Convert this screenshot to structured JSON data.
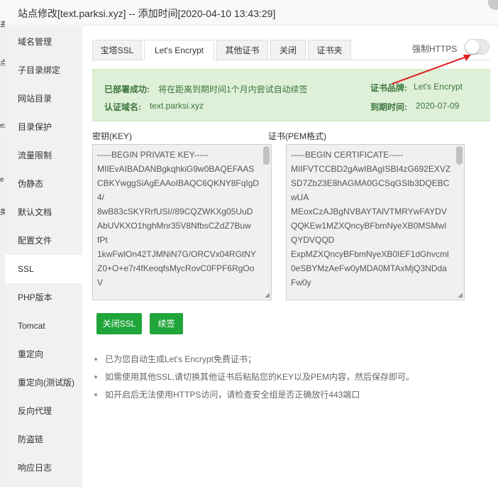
{
  "window": {
    "title": "站点修改[text.parksi.xyz] -- 添加时间[2020-04-10 13:43:29]"
  },
  "left_strip": [
    "丢",
    "点",
    "ext",
    "e",
    "类"
  ],
  "sidebar": {
    "items": [
      {
        "label": "域名管理"
      },
      {
        "label": "子目录绑定"
      },
      {
        "label": "网站目录"
      },
      {
        "label": "目录保护"
      },
      {
        "label": "流量限制"
      },
      {
        "label": "伪静态"
      },
      {
        "label": "默认文档"
      },
      {
        "label": "配置文件"
      },
      {
        "label": "SSL"
      },
      {
        "label": "PHP版本"
      },
      {
        "label": "Tomcat"
      },
      {
        "label": "重定向"
      },
      {
        "label": "重定向(测试版)"
      },
      {
        "label": "反向代理"
      },
      {
        "label": "防盗链"
      },
      {
        "label": "响应日志"
      }
    ],
    "active_index": 8
  },
  "tabs": [
    {
      "label": "宝塔SSL"
    },
    {
      "label": "Let's Encrypt"
    },
    {
      "label": "其他证书"
    },
    {
      "label": "关闭"
    },
    {
      "label": "证书夹"
    }
  ],
  "active_tab": "Let's Encrypt",
  "force_https": {
    "label": "强制HTTPS",
    "enabled": false
  },
  "status": {
    "deploy_label": "已部署成功:",
    "deploy_text": "将在距离到期时间1个月内尝试自动续签",
    "domain_label": "认证域名:",
    "domain_value": "text.parksi.xyz",
    "brand_label": "证书品牌:",
    "brand_value": "Let's Encrypt",
    "expiry_label": "到期时间:",
    "expiry_value": "2020-07-09"
  },
  "key_field": {
    "label": "密钥(KEY)",
    "lines": [
      "-----BEGIN PRIVATE KEY-----",
      "MIIEvAIBADANBgkqhkiG9w0BAQEFAAS",
      "CBKYwggSiAgEAAoIBAQC6QKNY8FqIgD",
      "4/",
      "8wB83cSKYRrfUSI//89CQZWKXg05UuD",
      "AbUVKXO1hghMnr35V8NfbsCZdZ7Buw",
      "fPt",
      "1kwFwlOn42TJMNiN7G/ORCVx04RGtNY",
      "Z0+O+e7r4fKeoqfsMycRovC0FPF6RgOo",
      "V"
    ]
  },
  "cert_field": {
    "label": "证书(PEM格式)",
    "lines": [
      "-----BEGIN CERTIFICATE-----",
      "MIIFVTCCBD2gAwIBAgISBI4zG692EXVZ",
      "SD7Zb23E8hAGMA0GCSqGSIb3DQEBC",
      "wUA",
      "MEoxCzAJBgNVBAYTAlVTMRYwFAYDV",
      "QQKEw1MZXQncyBFbmNyeXB0MSMwI",
      "QYDVQQD",
      "ExpMZXQncyBFbmNyeXB0IEF1dGhvcml",
      "0eSBYMzAeFw0yMDA0MTAxMjQ3NDda",
      "Fw0y"
    ]
  },
  "buttons": {
    "close_ssl": "关闭SSL",
    "renew": "续签"
  },
  "notes": [
    "已为您自动生成Let's Encrypt免费证书；",
    "如需使用其他SSL,请切换其他证书后粘贴您的KEY以及PEM内容，然后保存即可。",
    "如开启后无法使用HTTPS访问，请检查安全组是否正确放行443端口"
  ],
  "colors": {
    "accent_green": "#20a53a",
    "banner_bg": "#dff0d8",
    "banner_text": "#3c763d",
    "arrow": "#e02020"
  }
}
